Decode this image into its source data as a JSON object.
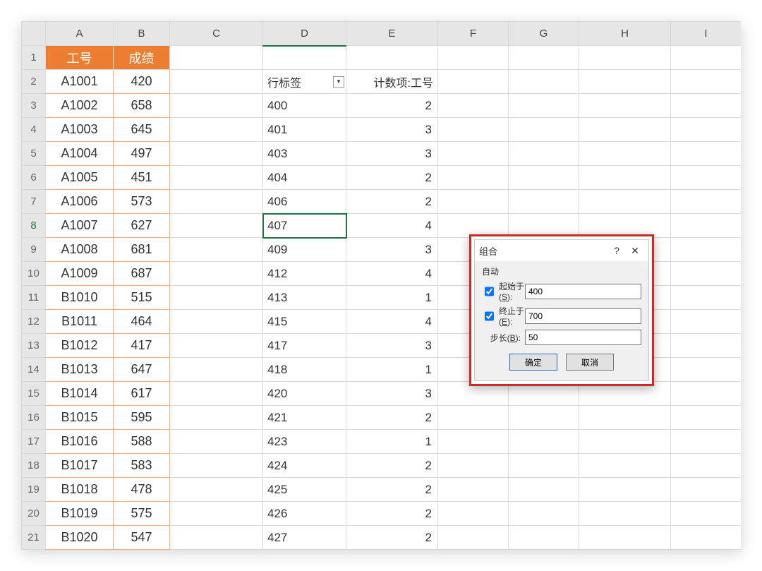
{
  "columns": [
    "A",
    "B",
    "C",
    "D",
    "E",
    "F",
    "G",
    "H",
    "I"
  ],
  "row_numbers": [
    1,
    2,
    3,
    4,
    5,
    6,
    7,
    8,
    9,
    10,
    11,
    12,
    13,
    14,
    15,
    16,
    17,
    18,
    19,
    20,
    21
  ],
  "header_row": {
    "A": "工号",
    "B": "成绩"
  },
  "data_ab": [
    {
      "A": "A1001",
      "B": "420"
    },
    {
      "A": "A1002",
      "B": "658"
    },
    {
      "A": "A1003",
      "B": "645"
    },
    {
      "A": "A1004",
      "B": "497"
    },
    {
      "A": "A1005",
      "B": "451"
    },
    {
      "A": "A1006",
      "B": "573"
    },
    {
      "A": "A1007",
      "B": "627"
    },
    {
      "A": "A1008",
      "B": "681"
    },
    {
      "A": "A1009",
      "B": "687"
    },
    {
      "A": "B1010",
      "B": "515"
    },
    {
      "A": "B1011",
      "B": "464"
    },
    {
      "A": "B1012",
      "B": "417"
    },
    {
      "A": "B1013",
      "B": "647"
    },
    {
      "A": "B1014",
      "B": "617"
    },
    {
      "A": "B1015",
      "B": "595"
    },
    {
      "A": "B1016",
      "B": "588"
    },
    {
      "A": "B1017",
      "B": "583"
    },
    {
      "A": "B1018",
      "B": "478"
    },
    {
      "A": "B1019",
      "B": "575"
    },
    {
      "A": "B1020",
      "B": "547"
    }
  ],
  "pivot": {
    "row_label": "行标签",
    "count_label": "计数项:工号",
    "rows": [
      {
        "label": "400",
        "count": "2"
      },
      {
        "label": "401",
        "count": "3"
      },
      {
        "label": "403",
        "count": "3"
      },
      {
        "label": "404",
        "count": "2"
      },
      {
        "label": "406",
        "count": "2"
      },
      {
        "label": "407",
        "count": "4"
      },
      {
        "label": "409",
        "count": "3"
      },
      {
        "label": "412",
        "count": "4"
      },
      {
        "label": "413",
        "count": "1"
      },
      {
        "label": "415",
        "count": "4"
      },
      {
        "label": "417",
        "count": "3"
      },
      {
        "label": "418",
        "count": "1"
      },
      {
        "label": "420",
        "count": "3"
      },
      {
        "label": "421",
        "count": "2"
      },
      {
        "label": "423",
        "count": "1"
      },
      {
        "label": "424",
        "count": "2"
      },
      {
        "label": "425",
        "count": "2"
      },
      {
        "label": "426",
        "count": "2"
      },
      {
        "label": "427",
        "count": "2"
      }
    ],
    "selected_row_index": 5
  },
  "dialog": {
    "title": "组合",
    "section": "自动",
    "start_label_pre": "起始于(",
    "start_key": "S",
    "end_label_pre": "终止于(",
    "end_key": "E",
    "step_label_pre": "步长(",
    "step_key": "B",
    "label_suffix": "):",
    "start_value": "400",
    "end_value": "700",
    "step_value": "50",
    "ok": "确定",
    "cancel": "取消"
  }
}
